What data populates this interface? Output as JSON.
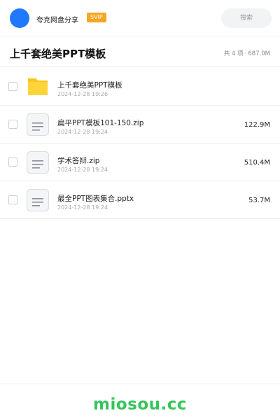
{
  "header": {
    "account_name": "夸克网盘分享",
    "badge": "SVIP",
    "search_placeholder": "搜索",
    "avatar_color": "#1f78ff"
  },
  "share": {
    "title": "上千套绝美PPT模板",
    "count_text": "共 4 项",
    "separator": "·",
    "total_size": "687.0M"
  },
  "files": [
    {
      "icon": "folder-icon",
      "name": "上千套绝美PPT模板",
      "date": "2024-12-28 19:26",
      "size": ""
    },
    {
      "icon": "document-icon",
      "name": "扁平PPT模板101-150.zip",
      "date": "2024-12-28 19:24",
      "size": "122.9M"
    },
    {
      "icon": "document-icon",
      "name": "学术答辩.zip",
      "date": "2024-12-28 19:24",
      "size": "510.4M"
    },
    {
      "icon": "document-icon",
      "name": "最全PPT图表集合.pptx",
      "date": "2024-12-28 19:24",
      "size": "53.7M"
    }
  ],
  "footer": {
    "brand": "miosou.cc",
    "brand_color": "#35c55b"
  }
}
